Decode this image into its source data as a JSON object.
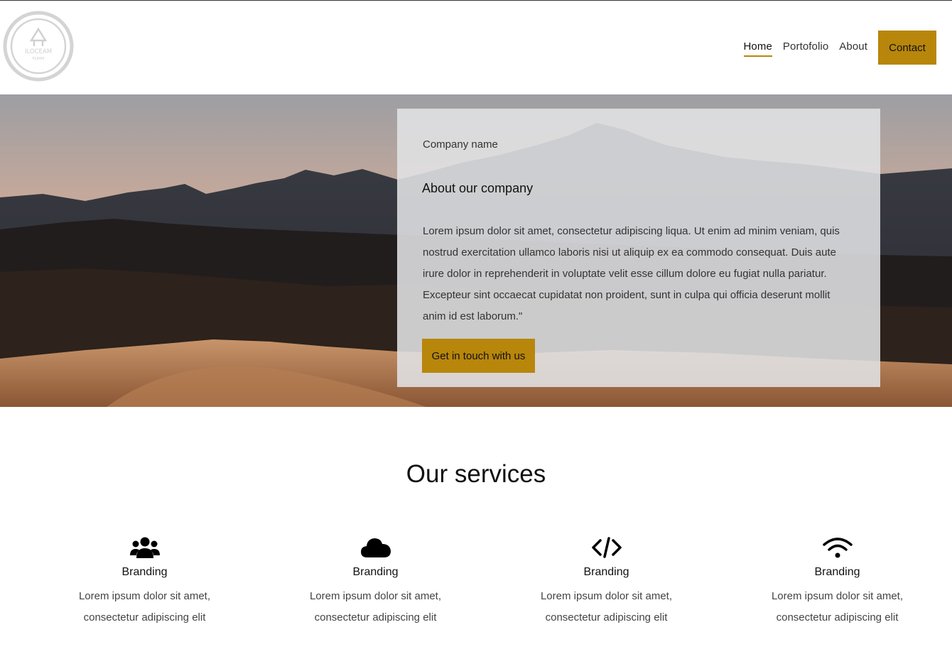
{
  "header": {
    "logo": {
      "icon": "logo-badge",
      "text_top": "ILOCEAM",
      "text_bottom": "PLEAM"
    },
    "nav": [
      {
        "label": "Home",
        "active": true
      },
      {
        "label": "Portofolio",
        "active": false
      },
      {
        "label": "About",
        "active": false
      }
    ],
    "contact_label": "Contact"
  },
  "hero": {
    "company_name": "Company name",
    "title": "About our company",
    "body": "Lorem ipsum dolor sit amet, consectetur adipiscing liqua. Ut enim ad minim veniam, quis nostrud exercitation ullamco laboris nisi ut aliquip ex ea commodo consequat. Duis aute irure dolor in reprehenderit in voluptate velit esse cillum dolore eu fugiat nulla pariatur. Excepteur sint occaecat cupidatat non proident, sunt in culpa qui officia deserunt mollit anim id est laborum.\"",
    "cta_label": "Get in touch with us"
  },
  "services": {
    "title": "Our services",
    "items": [
      {
        "icon": "users-icon",
        "title": "Branding",
        "line1": "Lorem ipsum dolor sit amet,",
        "line2": "consectetur adipiscing elit"
      },
      {
        "icon": "cloud-icon",
        "title": "Branding",
        "line1": "Lorem ipsum dolor sit amet,",
        "line2": "consectetur adipiscing elit"
      },
      {
        "icon": "code-icon",
        "title": "Branding",
        "line1": "Lorem ipsum dolor sit amet,",
        "line2": "consectetur adipiscing elit"
      },
      {
        "icon": "wifi-icon",
        "title": "Branding",
        "line1": "Lorem ipsum dolor sit amet,",
        "line2": "consectetur adipiscing elit"
      }
    ]
  },
  "colors": {
    "accent": "#b8860b",
    "text": "#111111",
    "card_bg": "#e1e2e5"
  }
}
